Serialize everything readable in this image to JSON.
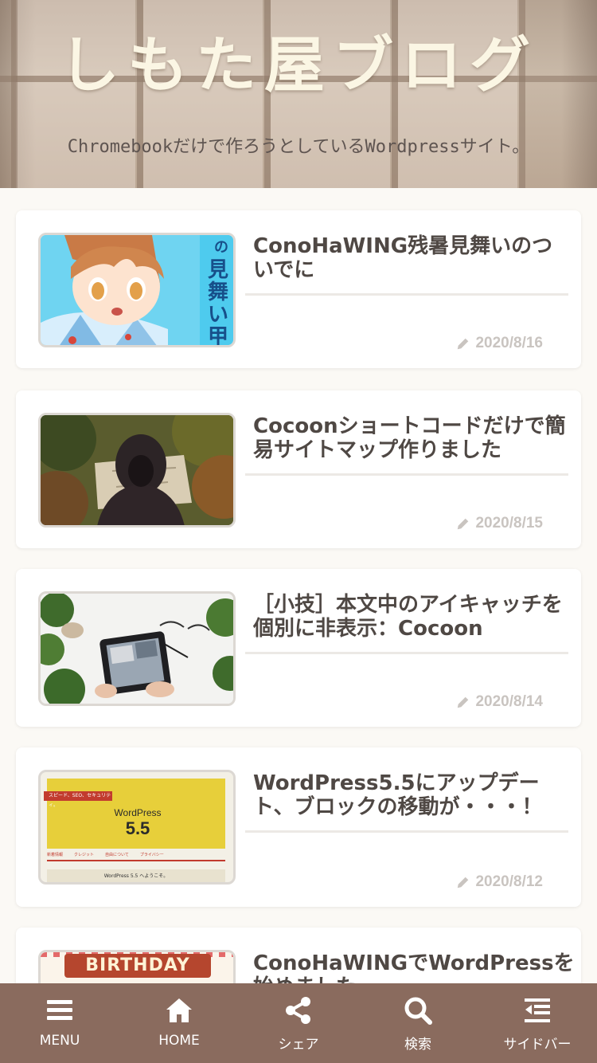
{
  "header": {
    "title": "しもた屋ブログ",
    "tagline": "Chromebookだけで作ろうとしているWordpressサイト。"
  },
  "posts": [
    {
      "title": "ConoHaWING残暑見舞いのついでに",
      "date": "2020/8/16",
      "thumb": "anime-thumbnail",
      "thumb_text": "の見舞い 申し上げます"
    },
    {
      "title": "Cocoonショートコードだけで簡易サイトマップ作りました",
      "date": "2020/8/15",
      "thumb": "map-thumbnail"
    },
    {
      "title": "［小技］本文中のアイキャッチを個別に非表示：Cocoon",
      "date": "2020/8/14",
      "thumb": "tablet-thumbnail"
    },
    {
      "title": "WordPress5.5にアップデート、ブロックの移動が・・・！",
      "date": "2020/8/12",
      "thumb": "wordpress-thumbnail",
      "thumb_text": {
        "banner": "スピード、SEO、セキュリティ。",
        "brand": "WordPress",
        "version": "5.5",
        "tabs": [
          "新着情報",
          "クレジット",
          "自由について",
          "プライバシー"
        ],
        "welcome": "WordPress 5.5 へようこそ。"
      }
    },
    {
      "title": "ConoHaWINGでWordPressを始めました",
      "date": "",
      "thumb": "birthday-thumbnail",
      "thumb_text": "BIRTHDAY"
    }
  ],
  "nav": [
    {
      "label": "MENU",
      "icon": "menu-icon"
    },
    {
      "label": "HOME",
      "icon": "home-icon"
    },
    {
      "label": "シェア",
      "icon": "share-icon"
    },
    {
      "label": "検索",
      "icon": "search-icon"
    },
    {
      "label": "サイドバー",
      "icon": "sidebar-icon"
    }
  ],
  "colors": {
    "nav_bg": "#8a6b5e",
    "title_color": "#fbf6e4",
    "date_color": "#c9c4c0"
  }
}
